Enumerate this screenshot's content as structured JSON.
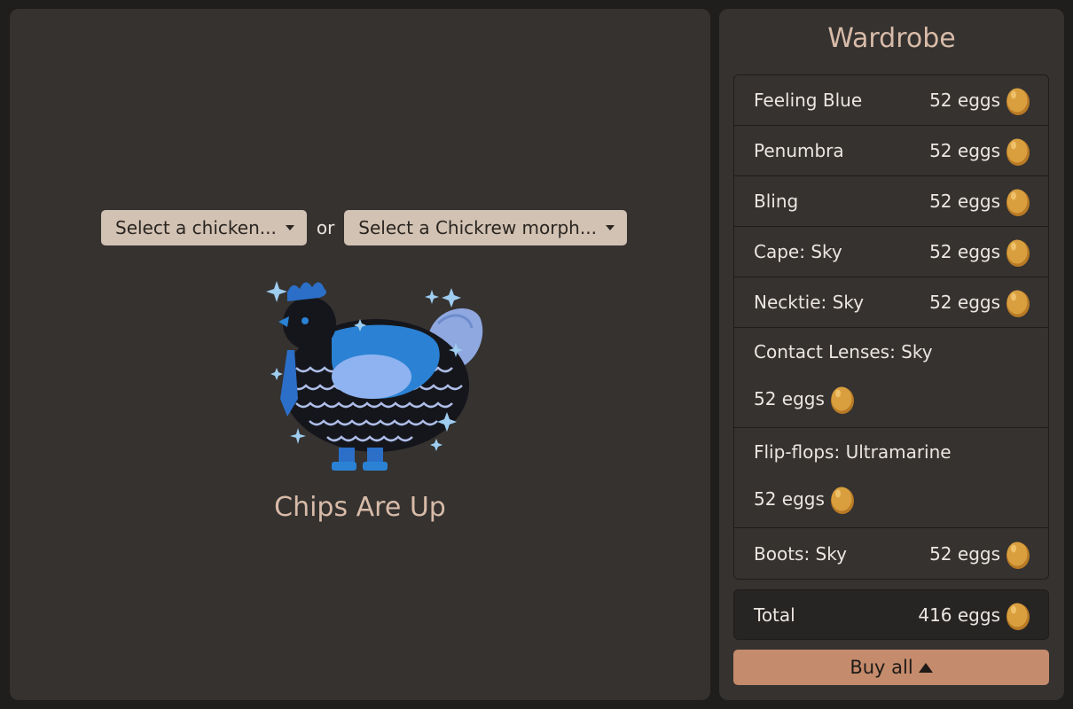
{
  "selectors": {
    "chicken_label": "Select a chicken...",
    "or_label": "or",
    "morph_label": "Select a Chickrew morph..."
  },
  "chicken": {
    "name": "Chips Are Up"
  },
  "wardrobe": {
    "title": "Wardrobe",
    "items": [
      {
        "name": "Feeling Blue",
        "price": "52 eggs"
      },
      {
        "name": "Penumbra",
        "price": "52 eggs"
      },
      {
        "name": "Bling",
        "price": "52 eggs"
      },
      {
        "name": "Cape: Sky",
        "price": "52 eggs"
      },
      {
        "name": "Necktie: Sky",
        "price": "52 eggs"
      },
      {
        "name": "Contact Lenses: Sky",
        "price": "52 eggs"
      },
      {
        "name": "Flip-flops: Ultramarine",
        "price": "52 eggs"
      },
      {
        "name": "Boots: Sky",
        "price": "52 eggs"
      }
    ],
    "total_label": "Total",
    "total_price": "416 eggs",
    "buy_all_label": "Buy all"
  },
  "colors": {
    "accent": "#c48b6c",
    "title": "#d8bba8",
    "panel": "#353230",
    "dropdown": "#d2c2b3",
    "egg": "#d39a3e"
  },
  "icons": {
    "egg": "egg-icon",
    "caret": "caret-down-icon",
    "buy": "triangle-up-icon"
  }
}
